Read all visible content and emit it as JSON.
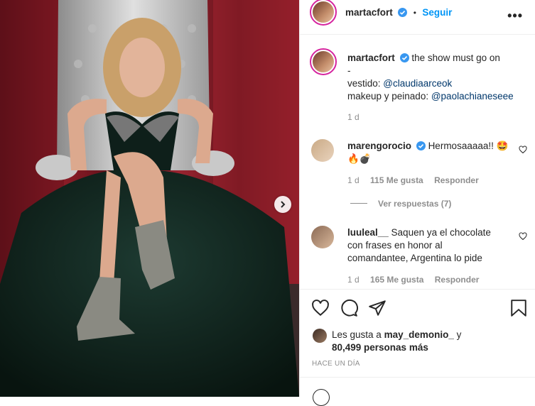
{
  "post": {
    "author": "martacfort",
    "follow_label": "Seguir",
    "more_label": "•••",
    "separator": "•"
  },
  "caption": {
    "author": "martacfort",
    "text": "the show must go on",
    "line2": "-",
    "line3_prefix": "vestido: ",
    "line3_mention": "@claudiaarceok",
    "line4_prefix": "makeup y peinado: ",
    "line4_mention": "@paolachianeseee",
    "time": "1 d"
  },
  "comments": [
    {
      "author": "marengorocio",
      "text": "Hermosaaaaa!! 🤩",
      "text2": "🔥💣",
      "time": "1 d",
      "likes": "115 Me gusta",
      "reply": "Responder",
      "view_replies": "Ver respuestas (7)"
    },
    {
      "author": "luuleal__",
      "text": "Saquen ya el chocolate",
      "text2": "con frases en honor al",
      "text3": "comandantee, Argentina lo pide",
      "time": "1 d",
      "likes": "165 Me gusta",
      "reply": "Responder"
    }
  ],
  "likes": {
    "prefix": "Les gusta a ",
    "user": "may_demonio_",
    "suffix": " y",
    "count": "80,499 personas más"
  },
  "timestamp": "HACE UN DÍA",
  "colors": {
    "accent": "#0095f6",
    "verified": "#3897f0",
    "mention": "#00376b"
  },
  "icons": [
    "heart-icon",
    "comment-icon",
    "share-icon",
    "bookmark-icon",
    "chevron-right-icon",
    "verified-icon"
  ]
}
